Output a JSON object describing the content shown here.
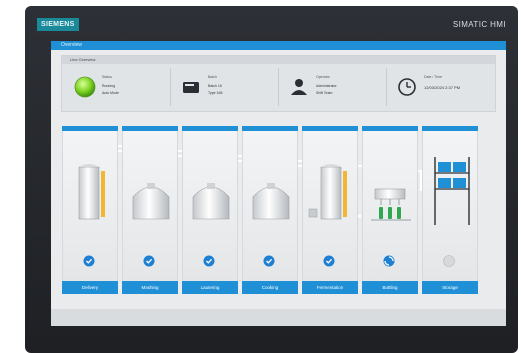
{
  "device": {
    "brand": "SIEMENS",
    "hmi_title": "SIMATIC HMI"
  },
  "screen": {
    "title": "Overview"
  },
  "panel": {
    "header": "Line Overview",
    "status": [
      {
        "label": "Status",
        "lines": [
          "Running",
          "Auto Mode"
        ],
        "icon": "status-lamp-icon"
      },
      {
        "label": "Batch",
        "lines": [
          "Batch 16",
          "Type 168"
        ],
        "icon": "batch-icon"
      },
      {
        "label": "Operator",
        "lines": [
          "Administrator",
          "Shift Team"
        ],
        "icon": "user-icon"
      },
      {
        "label": "Date / Time",
        "lines": [
          "12/03/2024 2:37 PM"
        ],
        "icon": "clock-icon"
      }
    ]
  },
  "stations": [
    {
      "name": "Delivery",
      "state": "ok"
    },
    {
      "name": "Mashing",
      "state": "ok"
    },
    {
      "name": "Lautering",
      "state": "ok"
    },
    {
      "name": "Cooking",
      "state": "ok"
    },
    {
      "name": "Fermentation",
      "state": "ok"
    },
    {
      "name": "Bottling",
      "state": "running"
    },
    {
      "name": "Storage",
      "state": "idle"
    }
  ],
  "colors": {
    "accent": "#1f8fd6",
    "ok": "#1f7fd0",
    "lamp": "#7ed321",
    "liquid": "#f2b632",
    "bottle": "#2fa84f"
  }
}
